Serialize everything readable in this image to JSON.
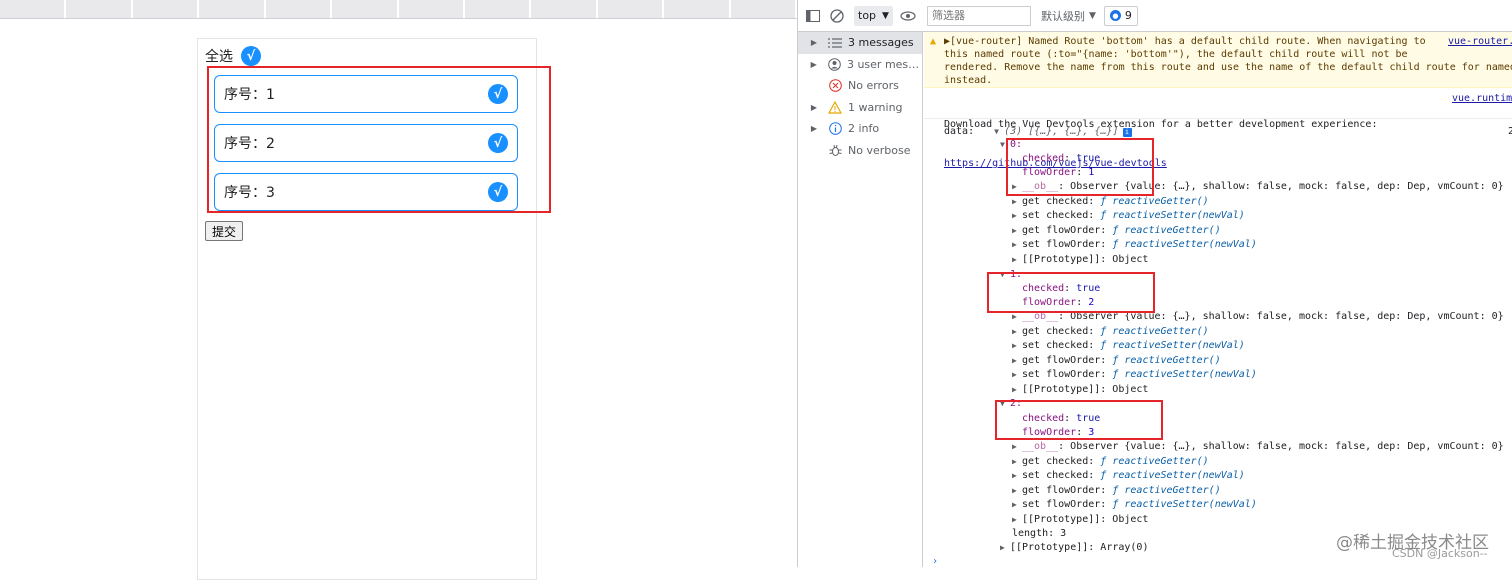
{
  "page": {
    "select_all_label": "全选",
    "check_mark": "√",
    "items": [
      {
        "label": "序号：1"
      },
      {
        "label": "序号：2"
      },
      {
        "label": "序号：3"
      }
    ],
    "submit_label": "提交",
    "accent_color": "#1890ff",
    "highlight_color": "#e5252a"
  },
  "devtools": {
    "toolbar": {
      "context": "top",
      "filter_placeholder": "筛选器",
      "levels_label": "默认级别",
      "issues_count": "9"
    },
    "sidebar": [
      {
        "label": "3 messages",
        "icon": "list-icon"
      },
      {
        "label": "3 user mess...",
        "icon": "user-icon"
      },
      {
        "label": "No errors",
        "icon": "error-icon"
      },
      {
        "label": "1 warning",
        "icon": "warning-icon"
      },
      {
        "label": "2 info",
        "icon": "info-icon"
      },
      {
        "label": "No verbose",
        "icon": "bug-icon"
      }
    ],
    "warning": {
      "lines": [
        "▶[vue-router] Named Route 'bottom' has a default child route. When navigating to",
        "this named route (:to=\"{name: 'bottom'\"), the default child route will not be",
        "rendered. Remove the name from this route and use the name of the default child route for named",
        "instead."
      ],
      "source": "vue-router.e"
    },
    "info": {
      "line1": "Download the Vue Devtools extension for a better development experience:",
      "link": "https://github.com/vuejs/vue-devtools",
      "source": "vue.runtime"
    },
    "tree": {
      "label": "data:",
      "summary": "(3) [{…}, {…}, {…}]",
      "line_no": "2",
      "items": [
        {
          "index": "0:",
          "checked": "true",
          "flowOrder": "1"
        },
        {
          "index": "1:",
          "checked": "true",
          "flowOrder": "2"
        },
        {
          "index": "2:",
          "checked": "true",
          "flowOrder": "3"
        }
      ],
      "ob_prefix": "__ob__",
      "ob_value": "Observer {value: {…}, shallow: false, mock: false, dep: Dep, vmCount: 0}",
      "getters": [
        {
          "label": "get checked",
          "fn": "reactiveGetter()"
        },
        {
          "label": "set checked",
          "fn": "reactiveSetter(newVal)"
        },
        {
          "label": "get flowOrder",
          "fn": "reactiveGetter()"
        },
        {
          "label": "set flowOrder",
          "fn": "reactiveSetter(newVal)"
        }
      ],
      "prototype_object": "[[Prototype]]: Object",
      "length": "length: 3",
      "prototype_array": "[[Prototype]]: Array(0)",
      "prompt": "›"
    }
  },
  "watermark": {
    "text": "@稀土掘金技术社区",
    "sub": "CSDN @Jackson--"
  }
}
